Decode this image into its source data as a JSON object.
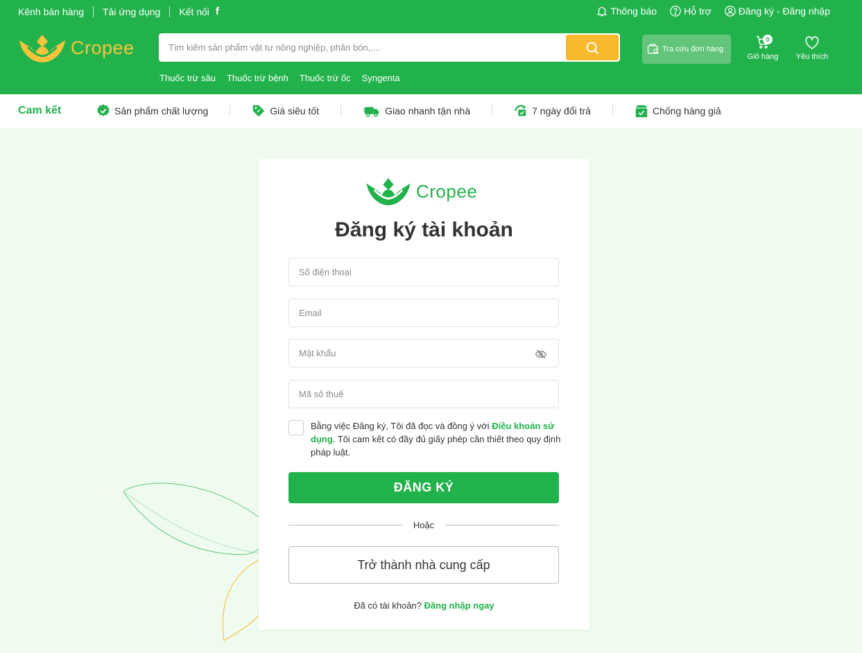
{
  "topbar": {
    "left_items": [
      "Kênh bán hàng",
      "Tải ứng dụng",
      "Kết nối"
    ],
    "facebook_icon": "f",
    "notifications": "Thông báo",
    "support": "Hỗ trợ",
    "account": "Đăng ký - Đăng nhập"
  },
  "header": {
    "logo_text": "Cropee",
    "search_placeholder": "Tìm kiếm sản phẩm vật tư nông nghiệp, phân bón,....",
    "quick_links": [
      "Thuốc trừ sâu",
      "Thuốc trừ bệnh",
      "Thuốc trừ ốc",
      "Syngenta"
    ],
    "order_lookup": "Tra cứu đơn hàng",
    "cart_label": "Giỏ hàng",
    "cart_count": "0",
    "wishlist_label": "Yêu thích"
  },
  "commitments": {
    "title": "Cam kết",
    "items": [
      {
        "label": "Sản phẩm chất lượng",
        "icon": "verified-badge-icon"
      },
      {
        "label": "Giá siêu tốt",
        "icon": "price-tag-icon"
      },
      {
        "label": "Giao nhanh tận nhà",
        "icon": "delivery-truck-icon"
      },
      {
        "label": "7 ngày đổi trả",
        "icon": "return-icon"
      },
      {
        "label": "Chống hàng giả",
        "icon": "anti-counterfeit-box-icon"
      }
    ]
  },
  "register": {
    "logo_text": "Cropee",
    "title": "Đăng ký tài khoản",
    "phone_placeholder": "Số điện thoại",
    "email_placeholder": "Email",
    "password_placeholder": "Mật khẩu",
    "tax_placeholder": "Mã số thuế",
    "terms_prefix": "Bằng việc Đăng ký, Tôi đã đọc và đồng ý với ",
    "terms_link": "Điều khoản sử dụng",
    "terms_suffix": ". Tôi cam kết có đầy đủ giấy phép cần thiết theo quy định pháp luật.",
    "submit_label": "ĐĂNG KÝ",
    "or_label": "Hoặc",
    "supplier_label": "Trở thành nhà cung cấp",
    "has_account": "Đã có tài khoản?",
    "login_link": "Đăng nhập ngay"
  },
  "colors": {
    "brand_green": "#22b24c",
    "brand_yellow": "#f9c43b",
    "search_button": "#f9b92e",
    "page_background": "#f0fbef"
  }
}
